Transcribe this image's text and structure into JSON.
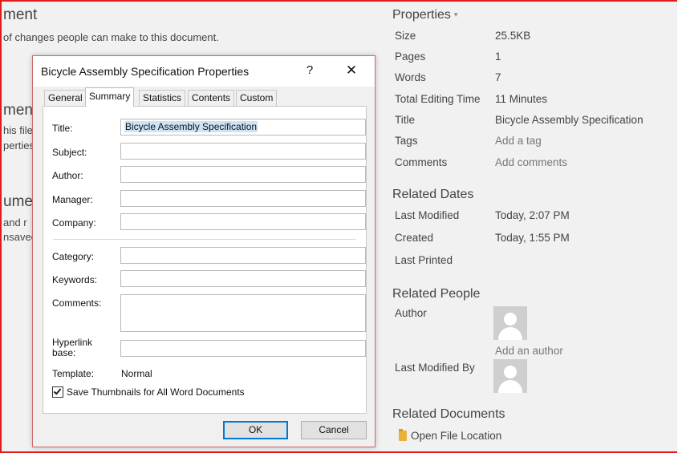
{
  "background_page": {
    "heading_1": "ment",
    "line_1": "of changes people can make to this document.",
    "heading_2": "men",
    "line_2": "his file",
    "line_3": "perties",
    "heading_3": "ume",
    "line_4": "and r",
    "line_5": "nsaved"
  },
  "properties_panel": {
    "title": "Properties",
    "caret": "▾",
    "rows": [
      {
        "label": "Size",
        "value": "25.5KB"
      },
      {
        "label": "Pages",
        "value": "1"
      },
      {
        "label": "Words",
        "value": "7"
      },
      {
        "label": "Total Editing Time",
        "value": "11 Minutes"
      },
      {
        "label": "Title",
        "value": "Bicycle Assembly Specification"
      },
      {
        "label": "Tags",
        "value": "Add a tag"
      },
      {
        "label": "Comments",
        "value": "Add comments"
      }
    ],
    "related_dates": {
      "heading": "Related Dates",
      "rows": [
        {
          "label": "Last Modified",
          "value": "Today, 2:07 PM"
        },
        {
          "label": "Created",
          "value": "Today, 1:55 PM"
        },
        {
          "label": "Last Printed",
          "value": ""
        }
      ]
    },
    "related_people": {
      "heading": "Related People",
      "author_label": "Author",
      "add_author": "Add an author",
      "last_modified_by_label": "Last Modified By"
    },
    "related_documents": {
      "heading": "Related Documents",
      "open_file_location": "Open File Location"
    }
  },
  "dialog": {
    "title": "Bicycle Assembly Specification Properties",
    "help_glyph": "?",
    "close_glyph": "✕",
    "tabs": [
      "General",
      "Summary",
      "Statistics",
      "Contents",
      "Custom"
    ],
    "active_tab": "Summary",
    "fields": {
      "title_label": "Title:",
      "title_value": "Bicycle Assembly Specification",
      "subject_label": "Subject:",
      "author_label": "Author:",
      "manager_label": "Manager:",
      "company_label": "Company:",
      "category_label": "Category:",
      "keywords_label": "Keywords:",
      "comments_label": "Comments:",
      "hyperlink_label_1": "Hyperlink",
      "hyperlink_label_2": "base:",
      "template_label": "Template:",
      "template_value": "Normal"
    },
    "checkbox_label": "Save Thumbnails for All Word Documents",
    "checkbox_checked": true,
    "ok_label": "OK",
    "cancel_label": "Cancel"
  }
}
